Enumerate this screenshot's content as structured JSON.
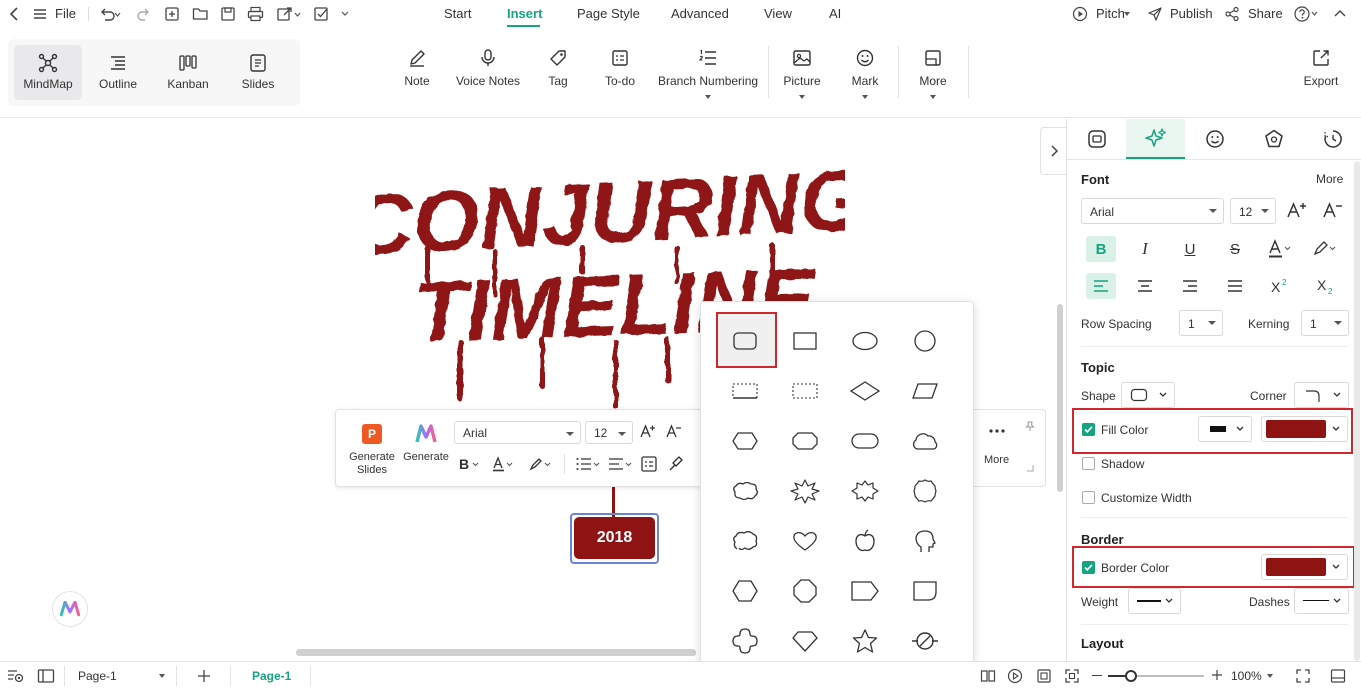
{
  "menubar": {
    "file": "File",
    "tabs": [
      "Start",
      "Insert",
      "Page Style",
      "Advanced",
      "View",
      "AI"
    ],
    "active_tab": "Insert",
    "pitch": "Pitch",
    "publish": "Publish",
    "share": "Share"
  },
  "views": [
    "MindMap",
    "Outline",
    "Kanban",
    "Slides"
  ],
  "toolbar": {
    "note": "Note",
    "voice_notes": "Voice Notes",
    "tag": "Tag",
    "todo": "To-do",
    "branch_numbering": "Branch Numbering",
    "picture": "Picture",
    "mark": "Mark",
    "more": "More",
    "export": "Export"
  },
  "canvas": {
    "title_line1": "CONJURING",
    "title_line2": "TIMELINE",
    "topic_text": "2018"
  },
  "floating_toolbar": {
    "generate_slides": "Generate Slides",
    "generate": "Generate",
    "font": "Arial",
    "size": "12",
    "more": "More"
  },
  "panel": {
    "font_section": "Font",
    "more": "More",
    "font_family": "Arial",
    "font_size": "12",
    "row_spacing_label": "Row Spacing",
    "row_spacing": "1",
    "kerning_label": "Kerning",
    "kerning": "1",
    "topic_section": "Topic",
    "shape_label": "Shape",
    "corner_label": "Corner",
    "fill_color_label": "Fill Color",
    "shadow_label": "Shadow",
    "customize_width_label": "Customize Width",
    "border_section": "Border",
    "border_color_label": "Border Color",
    "weight_label": "Weight",
    "dashes_label": "Dashes",
    "layout_section": "Layout"
  },
  "colors": {
    "accent": "#16a37f",
    "topic_fill": "#8e1414",
    "title_red": "#8e1414",
    "highlight_red": "#d1262b"
  },
  "statusbar": {
    "page_select": "Page-1",
    "page_tab": "Page-1",
    "zoom": "100%"
  }
}
